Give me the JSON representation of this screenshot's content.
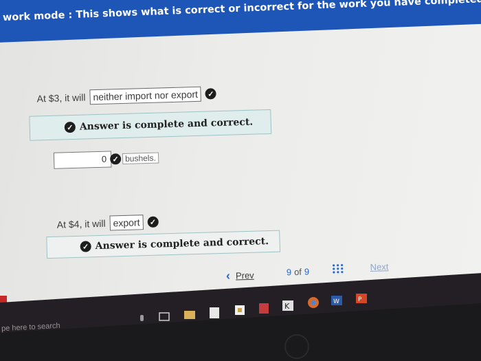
{
  "banner": {
    "text": "work mode : This shows what is correct or incorrect for the work you have completed so far. It do"
  },
  "q1": {
    "prefix": "At $3, it will",
    "selected": "neither import nor export"
  },
  "feedback1": {
    "text": "Answer is complete and correct."
  },
  "q1_quantity": {
    "value": "0",
    "units": "bushels."
  },
  "q2": {
    "prefix": "At $4, it will",
    "selected": "export"
  },
  "feedback2": {
    "text": "Answer is complete and correct."
  },
  "nav": {
    "prev_label": "Prev",
    "current": "9",
    "of_label": "of",
    "total": "9",
    "next_label": "Next"
  },
  "taskbar": {
    "search_placeholder": "pe here to search"
  },
  "colors": {
    "banner": "#1e56b8",
    "link": "#2a66c9",
    "check": "#1d1d1d",
    "answer_box": "#dfeeed"
  },
  "icons": [
    "check-icon",
    "chevron-left-icon",
    "grid-icon",
    "mic-icon",
    "task-view-icon",
    "file-explorer-icon",
    "calculator-icon",
    "store-icon",
    "onenote-icon",
    "sketch-icon",
    "chrome-icon",
    "word-icon",
    "powerpoint-icon"
  ]
}
